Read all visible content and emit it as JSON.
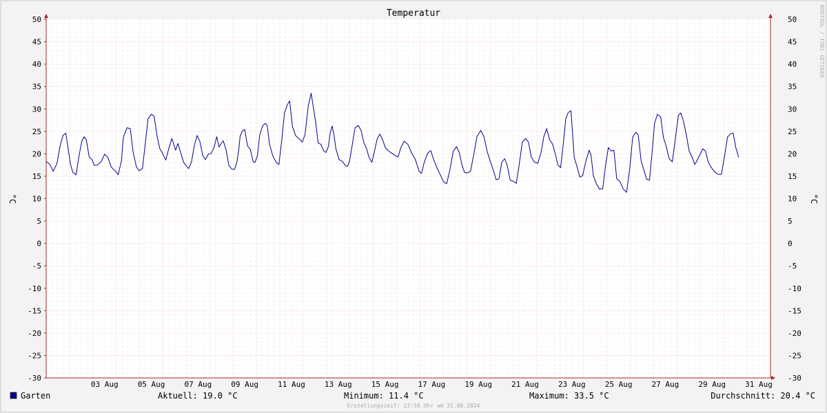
{
  "chart_data": {
    "type": "line",
    "title": "Temperatur",
    "ylabel": "°C",
    "ylim": [
      -30,
      50
    ],
    "y_ticks": [
      50,
      45,
      40,
      35,
      30,
      25,
      20,
      15,
      10,
      5,
      0,
      -5,
      -10,
      -15,
      -20,
      -25,
      -30
    ],
    "x_tick_labels": [
      "03 Aug",
      "05 Aug",
      "07 Aug",
      "09 Aug",
      "11 Aug",
      "13 Aug",
      "15 Aug",
      "17 Aug",
      "19 Aug",
      "21 Aug",
      "23 Aug",
      "25 Aug",
      "27 Aug",
      "29 Aug",
      "31 Aug"
    ],
    "grid": true,
    "series": [
      {
        "name": "Garten",
        "color": "#00008b",
        "x_days": [
          1,
          1.16,
          1.3,
          1.46,
          1.6,
          1.72,
          1.84,
          1.96,
          2.04,
          2.14,
          2.28,
          2.4,
          2.52,
          2.62,
          2.72,
          2.84,
          2.96,
          3.06,
          3.2,
          3.36,
          3.5,
          3.64,
          3.78,
          3.86,
          3.96,
          4.08,
          4.22,
          4.3,
          4.46,
          4.6,
          4.72,
          4.86,
          4.98,
          5.12,
          5.24,
          5.36,
          5.5,
          5.62,
          5.74,
          5.86,
          5.98,
          6.12,
          6.26,
          6.38,
          6.46,
          6.54,
          6.64,
          6.76,
          6.88,
          6.98,
          7.1,
          7.22,
          7.34,
          7.46,
          7.58,
          7.7,
          7.82,
          7.94,
          8.06,
          8.18,
          8.3,
          8.4,
          8.48,
          8.58,
          8.7,
          8.82,
          8.94,
          9.06,
          9.16,
          9.24,
          9.3,
          9.4,
          9.5,
          9.62,
          9.74,
          9.86,
          9.94,
          10.04,
          10.14,
          10.26,
          10.38,
          10.46,
          10.56,
          10.7,
          10.84,
          10.96,
          11.08,
          11.2,
          11.32,
          11.42,
          11.54,
          11.68,
          11.82,
          11.96,
          12.08,
          12.22,
          12.34,
          12.44,
          12.54,
          12.64,
          12.76,
          12.88,
          12.98,
          13.08,
          13.16,
          13.24,
          13.32,
          13.4,
          13.54,
          13.68,
          13.8,
          13.9,
          13.98,
          14.08,
          14.22,
          14.36,
          14.48,
          14.6,
          14.7,
          14.82,
          14.94,
          15.06,
          15.16,
          15.28,
          15.4,
          15.52,
          15.66,
          15.8,
          15.94,
          16.06,
          16.18,
          16.32,
          16.48,
          16.64,
          16.8,
          16.96,
          17.06,
          17.2,
          17.34,
          17.46,
          17.58,
          17.72,
          17.86,
          18,
          18.14,
          18.28,
          18.42,
          18.56,
          18.68,
          18.8,
          18.9,
          19.02,
          19.16,
          19.3,
          19.44,
          19.6,
          19.74,
          19.88,
          20.02,
          20.14,
          20.26,
          20.38,
          20.5,
          20.62,
          20.74,
          20.86,
          20.98,
          21.12,
          21.24,
          21.38,
          21.52,
          21.64,
          21.76,
          21.9,
          22.04,
          22.18,
          22.3,
          22.42,
          22.54,
          22.68,
          22.8,
          22.9,
          23.02,
          23.12,
          23.24,
          23.34,
          23.46,
          23.6,
          23.72,
          23.84,
          23.96,
          24.1,
          24.24,
          24.32,
          24.42,
          24.54,
          24.68,
          24.82,
          24.94,
          25.06,
          25.18,
          25.3,
          25.42,
          25.56,
          25.7,
          25.84,
          25.98,
          26.1,
          26.24,
          26.34,
          26.46,
          26.58,
          26.7,
          26.82,
          26.92,
          27.04,
          27.16,
          27.3,
          27.42,
          27.54,
          27.66,
          27.8,
          27.94,
          28.06,
          28.16,
          28.28,
          28.4,
          28.52,
          28.64,
          28.76,
          28.86,
          28.98,
          29.1,
          29.22,
          29.34,
          29.48,
          29.62,
          29.76,
          29.9,
          30.04,
          30.16,
          30.28,
          30.4,
          30.52,
          30.64,
          30.76,
          30.86,
          30.98,
          31.1,
          31.22,
          31.32,
          31.42,
          31.52,
          31.64,
          31.76,
          31.88,
          32
        ],
        "values": [
          18.3,
          17.6,
          16.1,
          17.8,
          21.8,
          24.1,
          24.6,
          20.5,
          17.6,
          15.9,
          15.3,
          19.4,
          22.7,
          23.8,
          23.1,
          19.3,
          18.7,
          17.4,
          17.5,
          18.3,
          19.9,
          19.2,
          17.1,
          16.6,
          16.2,
          15.3,
          18.4,
          23.6,
          25.8,
          25.6,
          20.4,
          17.1,
          16.2,
          16.7,
          22.1,
          27.8,
          28.8,
          28.4,
          24.1,
          21.2,
          20.1,
          18.6,
          21.4,
          23.4,
          22.1,
          20.8,
          22.3,
          20.2,
          18.1,
          17.4,
          16.7,
          18.2,
          21.8,
          24.1,
          22.7,
          19.6,
          18.7,
          19.9,
          20.1,
          21.3,
          23.8,
          21.5,
          22.2,
          22.9,
          20.8,
          17.4,
          16.6,
          16.5,
          18.1,
          20.8,
          23.9,
          25.1,
          25.4,
          21.7,
          21,
          18.2,
          18.1,
          19.6,
          24.2,
          26.2,
          26.8,
          26.3,
          22.1,
          19.5,
          18.1,
          17.6,
          22.8,
          29.1,
          30.9,
          31.8,
          26.1,
          24,
          23.4,
          22.6,
          24.3,
          30.8,
          33.5,
          30.1,
          26.9,
          22.4,
          22.1,
          20.6,
          20.3,
          21.7,
          24.8,
          26.2,
          24.1,
          21.1,
          18.7,
          18.3,
          17.4,
          17.2,
          18.3,
          21.4,
          25.8,
          26.3,
          25.2,
          22.4,
          21.3,
          19.2,
          18.1,
          20.8,
          23.2,
          24.4,
          23.1,
          21.3,
          20.6,
          20.1,
          19.6,
          19.3,
          21.4,
          22.8,
          22.1,
          20.2,
          18.7,
          16.1,
          15.6,
          18.4,
          20.2,
          20.7,
          18.8,
          16.9,
          15.4,
          13.8,
          13.3,
          16.4,
          20.5,
          21.6,
          20.3,
          17.4,
          15.9,
          15.7,
          16.1,
          19.8,
          23.9,
          25.2,
          23.8,
          20.4,
          18.1,
          16.3,
          14.2,
          14.4,
          18.1,
          18.9,
          17.3,
          14.1,
          13.9,
          13.4,
          17.4,
          22.6,
          23.4,
          22.6,
          19.3,
          18.1,
          17.9,
          20.3,
          23.8,
          25.6,
          23.2,
          22.1,
          19.8,
          17.5,
          16.9,
          21.6,
          27.8,
          29.2,
          29.6,
          19.2,
          17.1,
          14.8,
          15.1,
          18.4,
          20.8,
          19.7,
          15.1,
          13.4,
          12.1,
          12.2,
          17.3,
          21.4,
          20.6,
          20.8,
          14.4,
          13.8,
          12.1,
          11.4,
          16.8,
          23.7,
          24.8,
          24.2,
          18.5,
          16.4,
          14.3,
          14.1,
          19.6,
          26.8,
          28.8,
          28.2,
          23.6,
          21.6,
          18.9,
          18.2,
          23.9,
          28.6,
          29.1,
          27.2,
          24.2,
          20.6,
          19.3,
          17.6,
          18.5,
          19.8,
          21.1,
          20.6,
          18.1,
          16.8,
          15.9,
          15.4,
          15.4,
          19.6,
          23.7,
          24.4,
          24.6,
          21.3,
          19.2
        ]
      }
    ]
  },
  "footer": {
    "legend_label": "Garten",
    "legend_color": "#00008b",
    "current": "Aktuell: 19.0 °C",
    "minimum": "Minimum: 11.4 °C",
    "maximum": "Maximum: 33.5 °C",
    "average": "Durchschnitt: 20.4 °C",
    "created": "Erstellungszeit: 23:58 Uhr am 31.08.2024"
  },
  "watermark": "RRDTOOL / TOBI OETIKER"
}
